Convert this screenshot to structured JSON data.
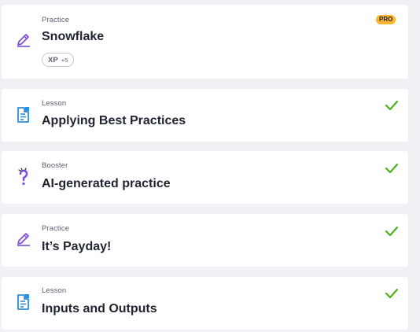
{
  "items": [
    {
      "kind": "Practice",
      "title": "Snowflake",
      "icon": "pencil-icon",
      "badge": "PRO",
      "xp_label": "XP",
      "xp_value": "+5",
      "completed": false
    },
    {
      "kind": "Lesson",
      "title": "Applying Best Practices",
      "icon": "document-icon",
      "completed": true
    },
    {
      "kind": "Booster",
      "title": "AI-generated practice",
      "icon": "question-sparkle-icon",
      "completed": true
    },
    {
      "kind": "Practice",
      "title": "It’s Payday!",
      "icon": "pencil-icon",
      "completed": true
    },
    {
      "kind": "Lesson",
      "title": "Inputs and Outputs",
      "icon": "document-icon",
      "completed": true
    }
  ],
  "colors": {
    "icon_purple": "#7c4dd6",
    "icon_blue": "#2f8fd6",
    "check_green": "#4caf1e",
    "pro_badge": "#fbb52d"
  }
}
